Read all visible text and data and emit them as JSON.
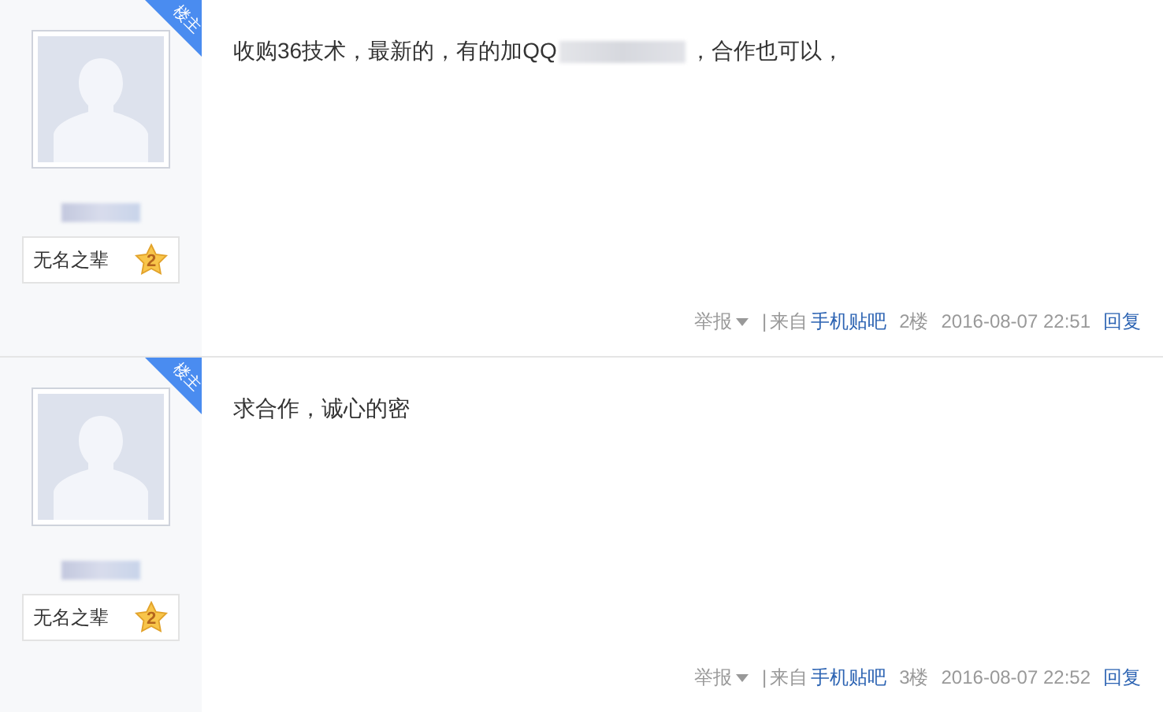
{
  "posts": [
    {
      "badge": "楼主",
      "level_title": "无名之辈",
      "level": "2",
      "content": [
        {
          "kind": "text",
          "text": "收购36技术，最新的，有的加QQ"
        },
        {
          "kind": "redacted"
        },
        {
          "kind": "text",
          "text": "，合作也可以，"
        }
      ],
      "report": "举报",
      "separator": "|",
      "source_prefix": "来自",
      "source": "手机贴吧",
      "floor": "2楼",
      "time": "2016-08-07 22:51",
      "reply": "回复"
    },
    {
      "badge": "楼主",
      "level_title": "无名之辈",
      "level": "2",
      "content": [
        {
          "kind": "text",
          "text": "求合作，诚心的密"
        }
      ],
      "report": "举报",
      "separator": "|",
      "source_prefix": "来自",
      "source": "手机贴吧",
      "floor": "3楼",
      "time": "2016-08-07 22:52",
      "reply": "回复"
    }
  ]
}
